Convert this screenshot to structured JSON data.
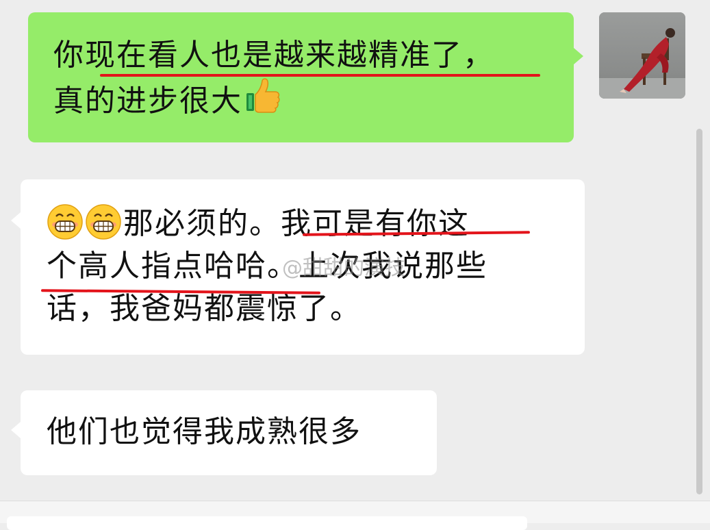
{
  "messages": [
    {
      "direction": "outgoing",
      "lines": [
        "你现在看人也是越来越精准了，",
        "真的进步很大"
      ],
      "trailing_emoji": "thumbs-up",
      "underlined_text": "在看人也是越来越精准了，"
    },
    {
      "direction": "incoming",
      "leading_emoji": [
        "grinning-face",
        "grinning-face"
      ],
      "lines": [
        "那必须的。我可是有你这",
        "个高人指点哈哈。上次我说那些",
        "话，我爸妈都震惊了。"
      ],
      "underlined_text": [
        "我可是有你这",
        "个高人指点哈哈"
      ]
    },
    {
      "direction": "incoming",
      "lines": [
        "他们也觉得我成熟很多"
      ]
    }
  ],
  "watermark": "@甜甜的演技",
  "colors": {
    "background": "#ededed",
    "outgoing_bubble": "#95ec69",
    "incoming_bubble": "#ffffff",
    "underline": "#e3141b"
  },
  "icons": {
    "thumbs_up": "thumbs-up-icon",
    "grin": "grinning-face-icon",
    "avatar": "user-avatar-photo"
  }
}
